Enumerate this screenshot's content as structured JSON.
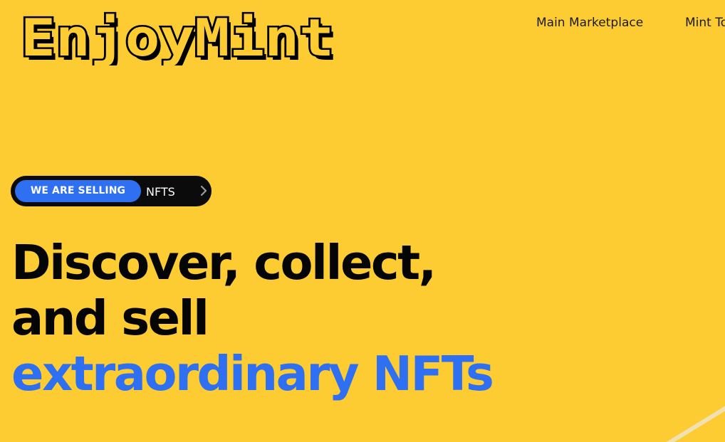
{
  "brand": {
    "logo_text": "EnjoyMint"
  },
  "nav": {
    "items": [
      {
        "label": "Main Marketplace"
      },
      {
        "label": "Mint To"
      }
    ]
  },
  "badge": {
    "chip_label": "WE ARE SELLING",
    "label": "NFTS",
    "icon": "chevron-right-icon"
  },
  "hero": {
    "line1": "Discover, collect,",
    "line2": "and sell",
    "line3": "extraordinary NFTs"
  },
  "colors": {
    "background": "#fccc32",
    "accent": "#2f6ff2",
    "text": "#050505"
  }
}
